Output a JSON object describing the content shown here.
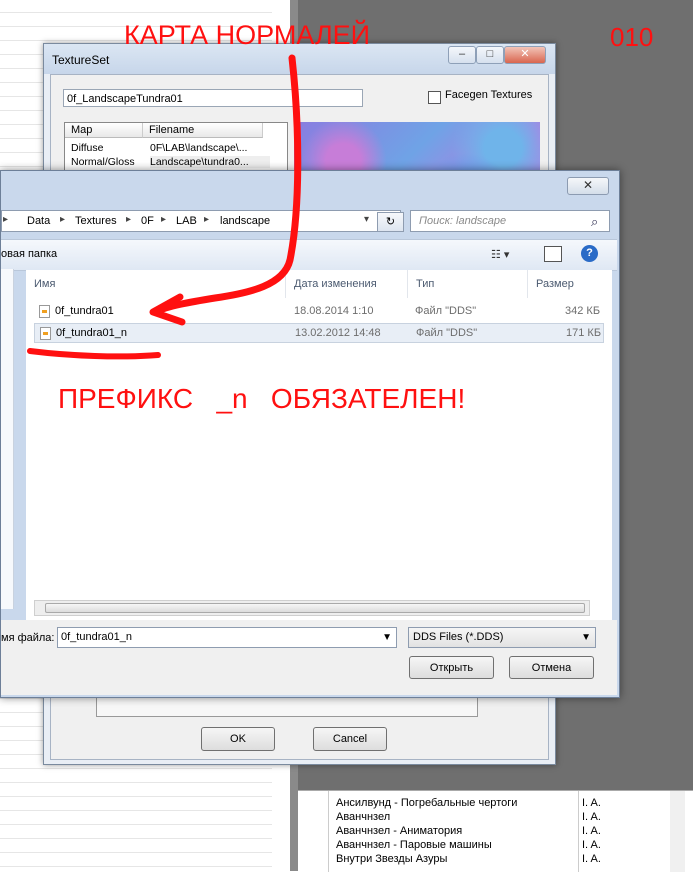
{
  "annotations": {
    "title": "КАРТА НОРМАЛЕЙ",
    "number": "010",
    "note": "ПРЕФИКС   _n   ОБЯЗАТЕЛЕН!"
  },
  "texture_set": {
    "window_title": "TextureSet",
    "name_value": "0f_LandscapeTundra01",
    "facegen_label": "Facegen Textures",
    "facegen_checked": false,
    "columns": [
      "Map",
      "Filename"
    ],
    "rows": [
      {
        "map": "Diffuse",
        "filename": "0F\\LAB\\landscape\\..."
      },
      {
        "map": "Normal/Gloss",
        "filename": "Landscape\\tundra0..."
      }
    ],
    "ok_label": "OK",
    "cancel_label": "Cancel"
  },
  "file_dialog": {
    "close_icon": "close-icon",
    "breadcrumbs": [
      "Data",
      "Textures",
      "0F",
      "LAB",
      "landscape"
    ],
    "search_placeholder": "Поиск: landscape",
    "new_folder_label": "овая папка",
    "columns": [
      "Имя",
      "Дата изменения",
      "Тип",
      "Размер"
    ],
    "files": [
      {
        "name": "0f_tundra01",
        "date": "18.08.2014 1:10",
        "type": "Файл \"DDS\"",
        "size": "342 КБ",
        "selected": false
      },
      {
        "name": "0f_tundra01_n",
        "date": "13.02.2012 14:48",
        "type": "Файл \"DDS\"",
        "size": "171 КБ",
        "selected": true
      }
    ],
    "filename_label": "мя файла:",
    "filename_value": "0f_tundra01_n",
    "filetype_value": "DDS Files (*.DDS)",
    "open_label": "Открыть",
    "cancel_label": "Отмена"
  },
  "bottom_list": [
    {
      "name": "Ансилвунд - Погребальные чертоги",
      "col": "I. A."
    },
    {
      "name": "Аванчнзел",
      "col": "I. A."
    },
    {
      "name": "Аванчнзел - Аниматория",
      "col": "I. A."
    },
    {
      "name": "Аванчнзел - Паровые машины",
      "col": "I. A."
    },
    {
      "name": "Внутри Звезды Азуры",
      "col": "I. A."
    }
  ],
  "colors": {
    "annotation": "#ff1010",
    "desktop": "#6f6f6f",
    "help_icon": "#2a6bc7"
  }
}
